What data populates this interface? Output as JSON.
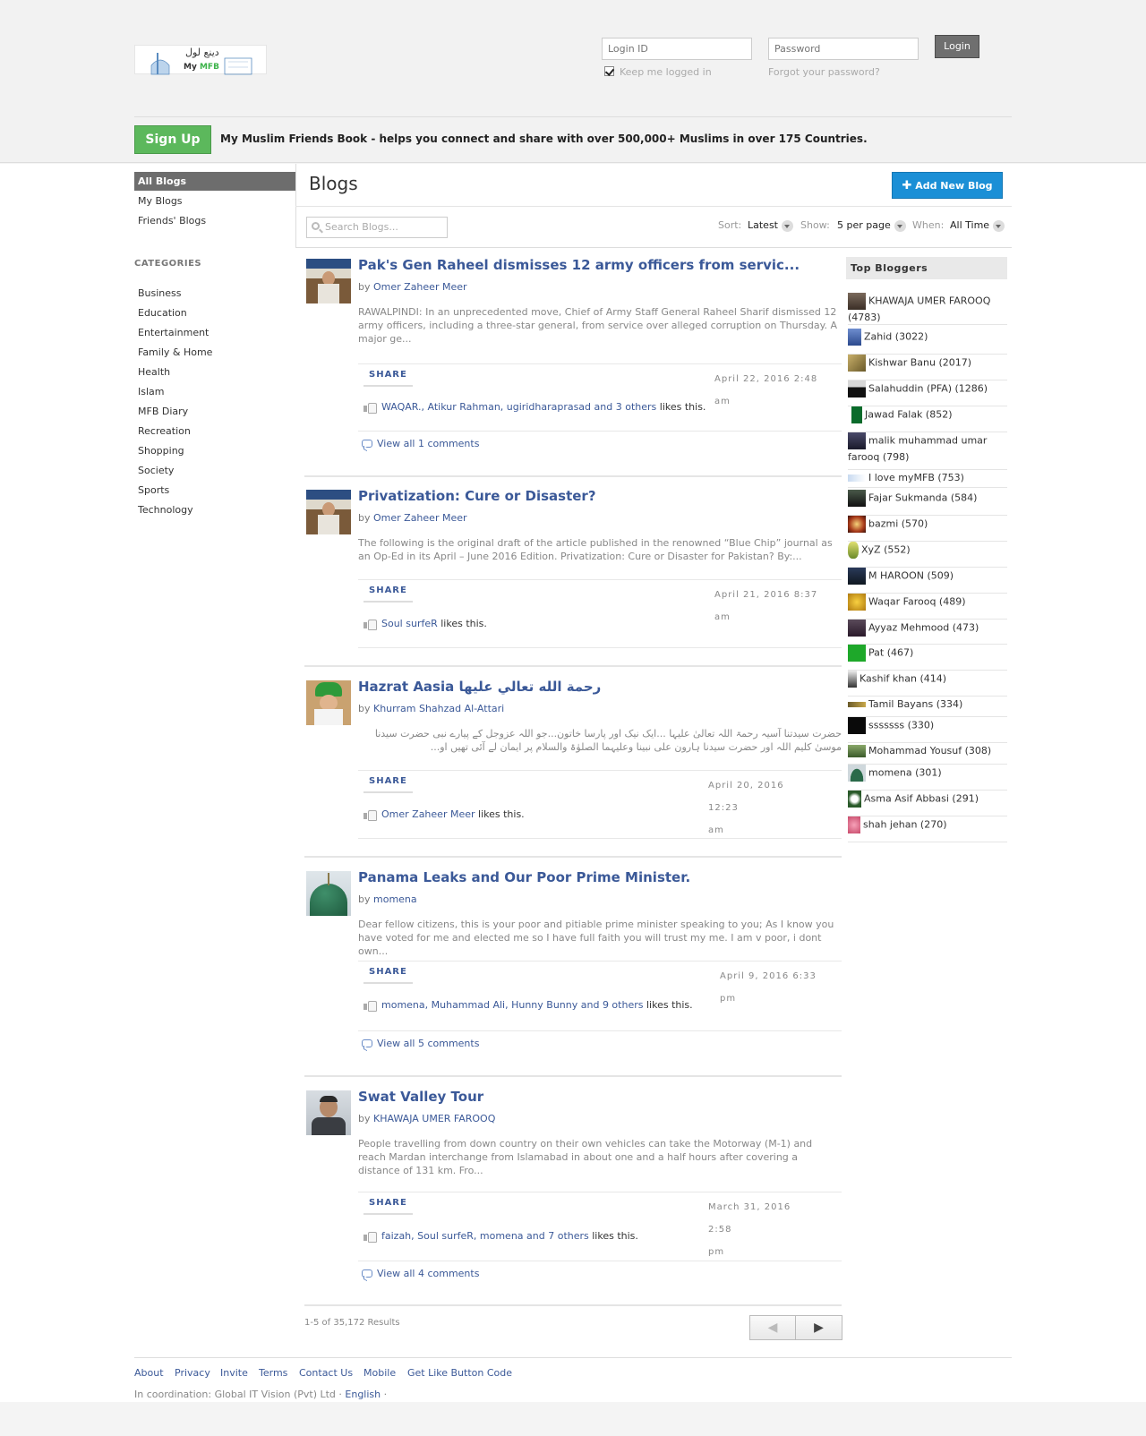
{
  "header": {
    "logo_text_a": "My",
    "logo_text_b": "MFB",
    "logo_urdu": "دینع لول",
    "login_placeholder": "Login ID",
    "password_placeholder": "Password",
    "login_label": "Login",
    "keep_logged": "Keep me logged in",
    "forgot": "Forgot your password?",
    "signup_label": "Sign Up",
    "tagline": "My Muslim Friends Book - helps you connect and share with over 500,000+ Muslims in over 175 Countries."
  },
  "nav": {
    "items": [
      "All Blogs",
      "My Blogs",
      "Friends' Blogs"
    ],
    "categories_title": "CATEGORIES",
    "categories": [
      "Business",
      "Education",
      "Entertainment",
      "Family & Home",
      "Health",
      "Islam",
      "MFB Diary",
      "Recreation",
      "Shopping",
      "Society",
      "Sports",
      "Technology"
    ]
  },
  "main": {
    "title": "Blogs",
    "add_blog": "Add New Blog",
    "search_placeholder": "Search Blogs...",
    "sort_label": "Sort:",
    "sort_value": "Latest",
    "show_label": "Show:",
    "show_value": "5 per page",
    "when_label": "When:",
    "when_value": "All Time"
  },
  "blogs": [
    {
      "title": "Pak's Gen Raheel dismisses 12 army officers from servic...",
      "by": "by",
      "author": "Omer Zaheer Meer",
      "excerpt": "RAWALPINDI: In an unprecedented move, Chief of Army Staff General Raheel Sharif dismissed 12 army officers, including a three-star general, from service over alleged corruption on Thursday. A major ge...",
      "share": "SHARE",
      "date_1": "April 22, 2016 2:48",
      "date_2": "am",
      "likers": "WAQAR., Atikur Rahman, ugiridharaprasad and 3 others",
      "likes_suffix": "likes this.",
      "comments": "View all 1 comments"
    },
    {
      "title": "Privatization: Cure or Disaster?",
      "by": "by",
      "author": "Omer Zaheer Meer",
      "excerpt": "The following is the original draft of the article published in the renowned “Blue Chip” journal as an Op-Ed  in its April – June 2016 Edition.   Privatization: Cure or Disaster for Pakistan?     By:...",
      "share": "SHARE",
      "date_1": "April 21, 2016 8:37",
      "date_2": "am",
      "likers": "Soul surfeR",
      "likes_suffix": "likes this.",
      "comments": ""
    },
    {
      "title": "Hazrat Aasia رحمة الله تعالي عليها",
      "by": "by",
      "author": "Khurram Shahzad Al-Attari",
      "excerpt": "حضرت سیدتنا آسیہ رحمۃ اللہ تعالیٰ علیہا ...ایک نیک اور پارسا خاتون...جو اللہ عزوجل کے پیارے نبی حضرت سیدنا موسیٰ کلیم اللہ اور حضرت سیدنا ہارون علی نبینا وعلیہما الصلوٰۃ والسلام پر ایمان لے آئی تھیں او...",
      "share": "SHARE",
      "date_1": "April 20, 2016 12:23",
      "date_2": "am",
      "likers": "Omer Zaheer Meer",
      "likes_suffix": "likes this.",
      "comments": ""
    },
    {
      "title": "Panama Leaks and Our Poor Prime Minister.",
      "by": "by",
      "author": "momena",
      "excerpt": "Dear fellow citizens, this is your poor and pitiable prime minister speaking to you; As I know you have voted for me and elected me so I have full faith you will trust my me.  I am v poor, i dont own...",
      "share": "SHARE",
      "date_1": "April 9, 2016 6:33",
      "date_2": "pm",
      "likers": "momena, Muhammad Ali, Hunny Bunny and 9 others",
      "likes_suffix": "likes this.",
      "comments": "View all 5 comments"
    },
    {
      "title": "Swat Valley Tour",
      "by": "by",
      "author": "KHAWAJA UMER FAROOQ",
      "excerpt": "People travelling from down country on their own vehicles can take the Motorway (M-1) and reach Mardan interchange from Islamabad in about one and a half hours after covering a distance of 131 km. Fro...",
      "share": "SHARE",
      "date_1": "March 31, 2016 2:58",
      "date_2": "pm",
      "likers": "faizah, Soul surfeR, momena and 7 others",
      "likes_suffix": "likes this.",
      "comments": "View all 4 comments"
    }
  ],
  "pagination": {
    "results": "1-5 of 35,172 Results",
    "prev": "◀",
    "next": "▶"
  },
  "top_bloggers": {
    "title": "Top Bloggers",
    "items": [
      "KHAWAJA UMER FAROOQ (4783)",
      "Zahid (3022)",
      "Kishwar Banu (2017)",
      "Salahuddin (PFA) (1286)",
      "Jawad Falak (852)",
      "malik muhammad umar farooq (798)",
      "I love myMFB (753)",
      "Fajar Sukmanda (584)",
      "bazmi (570)",
      "XyZ (552)",
      "M HAROON (509)",
      "Waqar Farooq (489)",
      "Ayyaz Mehmood (473)",
      "Pat (467)",
      "Kashif khan (414)",
      "Tamil Bayans (334)",
      "sssssss (330)",
      "Mohammad Yousuf (308)",
      "momena (301)",
      "Asma Asif Abbasi (291)",
      "shah jehan (270)"
    ]
  },
  "footer": {
    "links": [
      "About",
      "Privacy",
      "Invite",
      "Terms",
      "Contact Us",
      "Mobile",
      "Get Like Button Code"
    ],
    "coordination": "In coordination: Global IT Vision (Pvt) Ltd ·",
    "language": "English",
    "trail": "·"
  }
}
